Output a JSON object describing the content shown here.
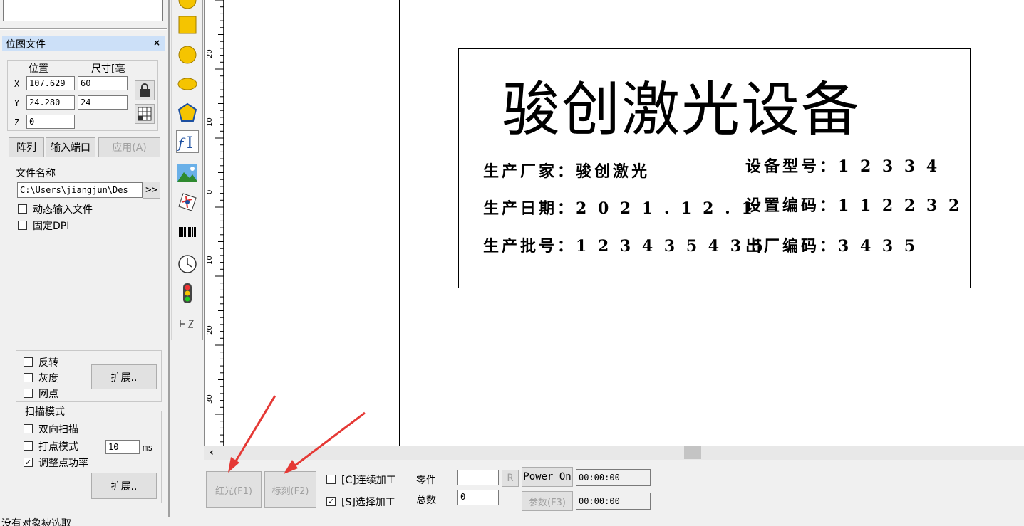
{
  "panel": {
    "title": "位图文件",
    "close": "×",
    "position_label": "位置",
    "size_label": "尺寸[毫",
    "x_label": "X",
    "y_label": "Y",
    "z_label": "Z",
    "x_pos": "107.629",
    "x_size": "60",
    "y_pos": "24.280",
    "y_size": "24",
    "z_pos": "0",
    "array_btn": "阵列",
    "input_port_btn": "输入端口",
    "apply_btn": "应用(A)",
    "file_name_label": "文件名称",
    "file_path": "C:\\Users\\jiangjun\\Des",
    "browse_btn": ">>",
    "dynamic_input": "动态输入文件",
    "fixed_dpi": "固定DPI",
    "invert": "反转",
    "grayscale": "灰度",
    "dither": "网点",
    "expand_btn1": "扩展..",
    "scan_mode": "扫描模式",
    "bidirectional": "双向扫描",
    "dot_mode": "打点模式",
    "dot_ms_value": "10",
    "ms_unit": "ms",
    "adjust_power": "调整点功率",
    "expand_btn2": "扩展.."
  },
  "ruler": {
    "labels": [
      "20",
      "10",
      "0",
      "10",
      "20",
      "30"
    ]
  },
  "label": {
    "title": "骏创激光设备",
    "manufacturer": "生产厂家：骏创激光",
    "model": "设备型号：1 2 3 3 4",
    "date": "生产日期：2 0 2 1 . 1 2 . 1",
    "setting_code": "设置编码：1 1 2 2 3 2",
    "batch": "生产批号：1 2 3 4 3 5 4 3 5",
    "factory_code": "出厂编码：3 4 3 5"
  },
  "bottom": {
    "red_light_btn": "红光(F1)",
    "mark_btn": "标刻(F2)",
    "continuous": "[C]连续加工",
    "select_process": "[S]选择加工",
    "parts_label": "零件",
    "total_label": "总数",
    "parts_value": "",
    "total_value": "0",
    "r_btn": "R",
    "power_on_btn": "Power On",
    "params_btn": "参数(F3)",
    "time1": "00:00:00",
    "time2": "00:00:00"
  },
  "status": {
    "text": "没有对象被选取"
  },
  "colors": {
    "accent": "#e53935",
    "title_bar": "#cce0f8",
    "tool_yellow": "#f5c400"
  }
}
